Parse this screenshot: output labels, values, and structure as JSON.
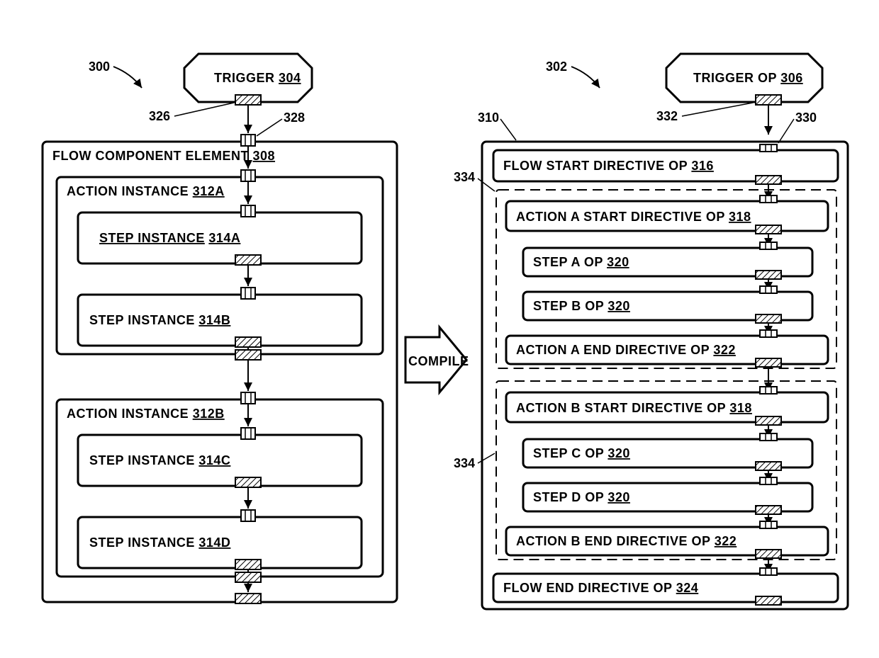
{
  "left": {
    "figref": "300",
    "trigger": {
      "label": "TRIGGER",
      "num": "304"
    },
    "out_port_ref": "326",
    "in_port_ref": "328",
    "flowcomp": {
      "label": "FLOW COMPONENT ELEMENT",
      "num": "308"
    },
    "actionA": {
      "label": "ACTION INSTANCE",
      "num": "312A"
    },
    "stepA": {
      "label": "STEP INSTANCE",
      "num": "314A"
    },
    "stepB": {
      "label": "STEP INSTANCE",
      "num": "314B"
    },
    "actionB": {
      "label": "ACTION INSTANCE",
      "num": "312B"
    },
    "stepC": {
      "label": "STEP INSTANCE",
      "num": "314C"
    },
    "stepD": {
      "label": "STEP INSTANCE",
      "num": "314D"
    }
  },
  "compile": "COMPILE",
  "right": {
    "figref": "302",
    "trigger": {
      "label": "TRIGGER OP",
      "num": "306"
    },
    "out_port_ref": "332",
    "in_port_ref": "330",
    "container_ref": "310",
    "flowstart": {
      "label": "FLOW START DIRECTIVE OP",
      "num": "316"
    },
    "group_ref": "334",
    "aStart": {
      "label": "ACTION A START DIRECTIVE OP",
      "num": "318"
    },
    "stepA": {
      "label": "STEP A OP",
      "num": "320"
    },
    "stepB": {
      "label": "STEP B OP",
      "num": "320"
    },
    "aEnd": {
      "label": "ACTION A END DIRECTIVE OP",
      "num": "322"
    },
    "bStart": {
      "label": "ACTION B START DIRECTIVE OP",
      "num": "318"
    },
    "stepC": {
      "label": "STEP C OP",
      "num": "320"
    },
    "stepD": {
      "label": "STEP D OP",
      "num": "320"
    },
    "bEnd": {
      "label": "ACTION B END DIRECTIVE OP",
      "num": "322"
    },
    "flowend": {
      "label": "FLOW END DIRECTIVE OP",
      "num": "324"
    }
  }
}
